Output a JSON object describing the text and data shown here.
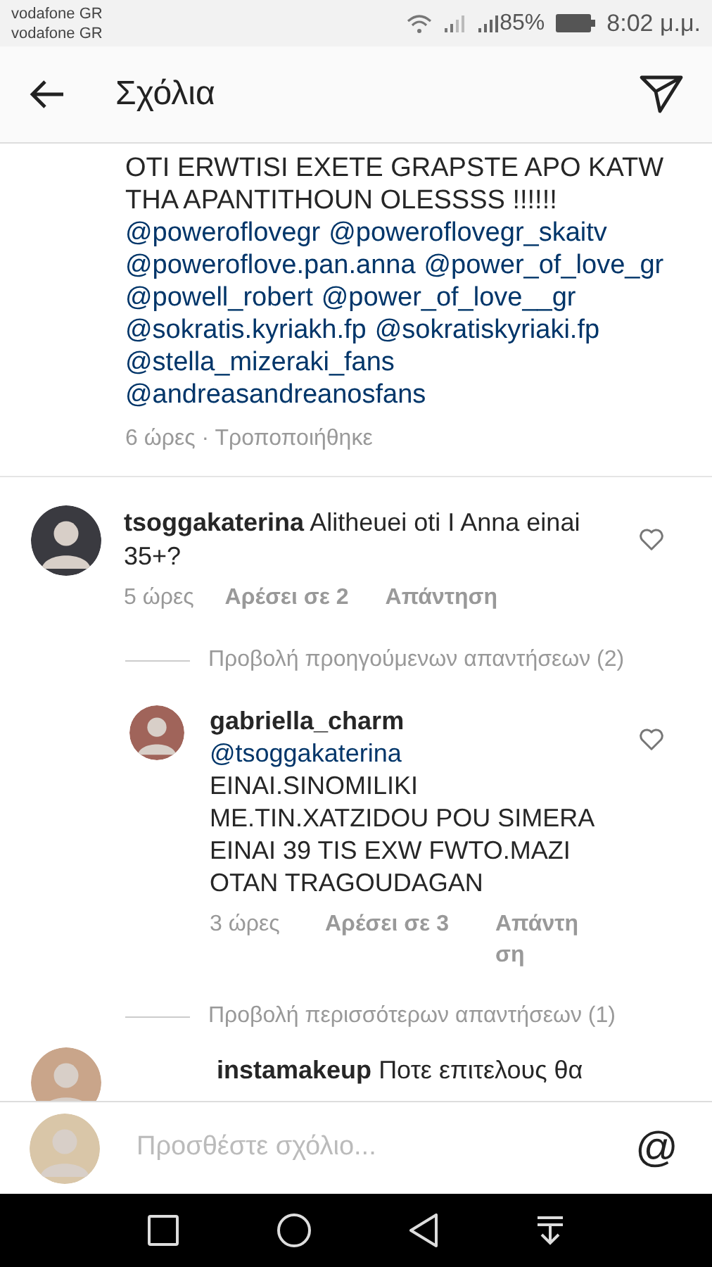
{
  "status_bar": {
    "carriers": [
      "vodafone GR",
      "vodafone GR"
    ],
    "battery": "85%",
    "time": "8:02 μ.μ."
  },
  "header": {
    "title": "Σχόλια"
  },
  "caption": {
    "text": "OTI ERWTISI EXETE GRAPSTE APO KATW THA APANTITHOUN OLESSSS !!!!!!",
    "mentions": [
      "@poweroflovegr",
      "@poweroflovegr_skaitv",
      "@poweroflove.pan.anna",
      "@power_of_love_gr",
      "@powell_robert",
      "@power_of_love__gr",
      "@sokratis.kyriakh.fp",
      "@sokratiskyriaki.fp",
      "@stella_mizeraki_fans",
      "@andreasandreanosfans"
    ],
    "meta": "6 ώρες · Τροποποιήθηκε"
  },
  "comments": [
    {
      "username": "tsoggakaterina",
      "text": "Alitheuei oti I Anna einai 35+?",
      "time": "5 ώρες",
      "likes": "Αρέσει σε 2",
      "reply": "Απάντηση",
      "view_previous": "Προβολή προηγούμενων απαντήσεων (2)",
      "replies": [
        {
          "username": "gabriella_charm",
          "mention": "@tsoggakaterina",
          "text": "EINAI.SINOMILIKI ME.TIN.XATZIDOU POU SIMERA EINAI 39 TIS EXW FWTO.MAZI OTAN TRAGOUDAGAN",
          "time": "3 ώρες",
          "likes": "Αρέσει σε 3",
          "reply": "Απάντηση"
        }
      ],
      "view_more": "Προβολή περισσότερων απαντήσεων (1)"
    },
    {
      "username": "instamakeup",
      "text": "Ποτε επιτελους θα"
    }
  ],
  "composer": {
    "placeholder": "Προσθέστε σχόλιο...",
    "mention_button": "@"
  }
}
